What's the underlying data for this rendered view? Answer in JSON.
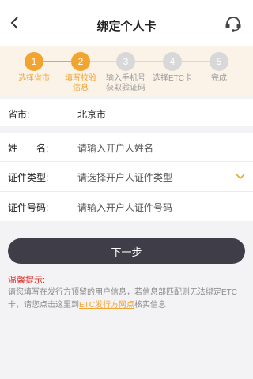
{
  "header": {
    "title": "绑定个人卡"
  },
  "steps": [
    {
      "number": "1",
      "label": "选择省市",
      "state": "done"
    },
    {
      "number": "2",
      "label": "填写校验信息",
      "state": "current"
    },
    {
      "number": "3",
      "label": "输入手机号获取验证码",
      "state": "todo"
    },
    {
      "number": "4",
      "label": "选择ETC卡",
      "state": "todo"
    },
    {
      "number": "5",
      "label": "完成",
      "state": "todo"
    }
  ],
  "form": {
    "province": {
      "label": "省市:",
      "value": "北京市"
    },
    "name": {
      "label": "姓　　名:",
      "placeholder": "请输入开户人姓名"
    },
    "id_type": {
      "label": "证件类型:",
      "placeholder": "请选择开户人证件类型"
    },
    "id_number": {
      "label": "证件号码:",
      "placeholder": "请输入开户人证件号码"
    }
  },
  "next_button": {
    "label": "下一步"
  },
  "tips": {
    "title": "温馨提示:",
    "body_before": "请您填写在发行方预留的用户信息，若信息部匹配则无法绑定ETC卡，请您点击这里到",
    "link": "ETC发行方网点",
    "body_after": "核实信息"
  },
  "colors": {
    "accent": "#f2a431",
    "step_inactive": "#d8d8d8",
    "button_bg": "#3f3e48",
    "tips_title": "#e0302a"
  }
}
